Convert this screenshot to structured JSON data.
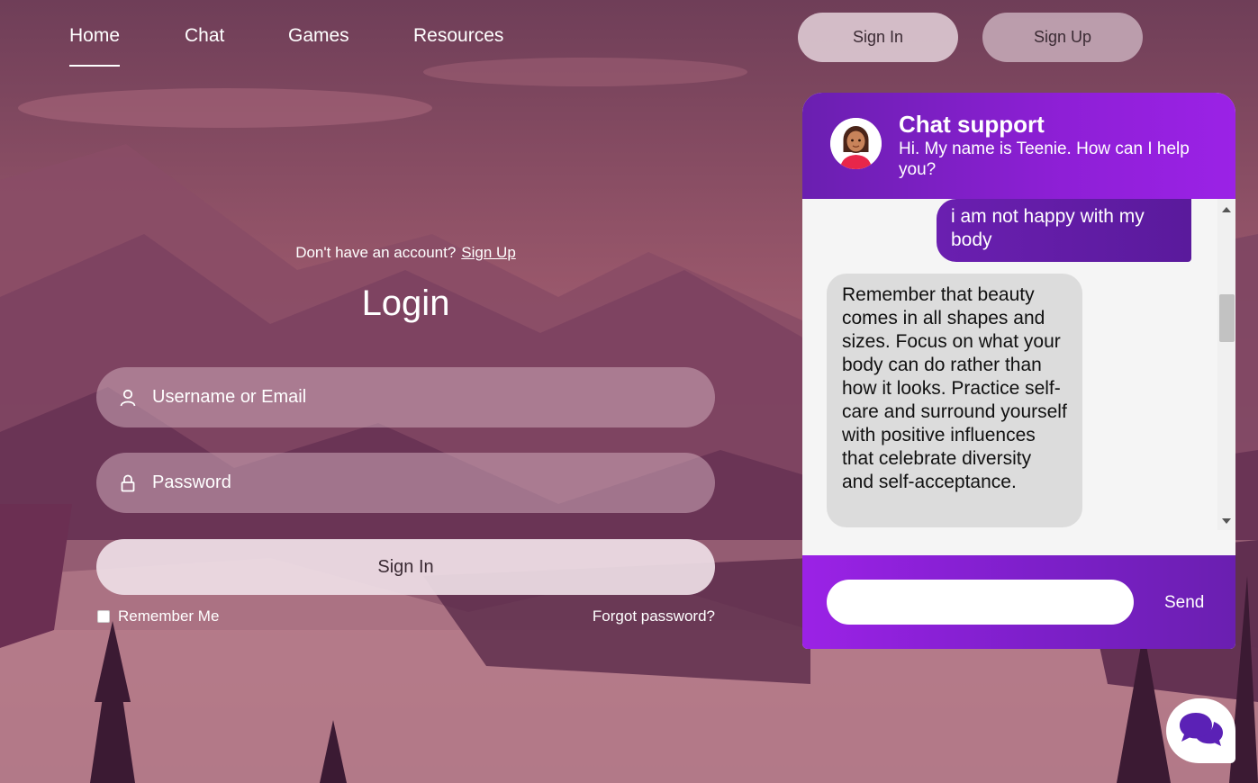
{
  "nav": {
    "items": [
      {
        "label": "Home",
        "active": true
      },
      {
        "label": "Chat",
        "active": false
      },
      {
        "label": "Games",
        "active": false
      },
      {
        "label": "Resources",
        "active": false
      }
    ],
    "sign_in_label": "Sign In",
    "sign_up_label": "Sign Up"
  },
  "login": {
    "account_prompt": "Don't have an account?",
    "signup_link": "Sign Up",
    "title": "Login",
    "username_placeholder": "Username or Email",
    "password_placeholder": "Password",
    "signin_button": "Sign In",
    "remember_me": "Remember Me",
    "forgot_password": "Forgot password?"
  },
  "chat": {
    "title": "Chat support",
    "subtitle": "Hi. My name is Teenie. How can I help you?",
    "messages": [
      {
        "from": "user",
        "text": "i am not happy with my body"
      },
      {
        "from": "bot",
        "text": "Remember that beauty comes in all shapes and sizes. Focus on what your body can do rather than how it looks. Practice self-care and surround yourself with positive influences that celebrate diversity and self-acceptance."
      }
    ],
    "input_value": "",
    "send_label": "Send"
  },
  "colors": {
    "chat_purple": "#8e1fd6",
    "chat_dark_purple": "#6a1fb0",
    "bot_bubble": "#dcdcdc"
  },
  "icons": {
    "username": "user-icon",
    "password": "lock-icon",
    "fab": "chat-bubbles-icon",
    "avatar": "avatar-icon"
  }
}
